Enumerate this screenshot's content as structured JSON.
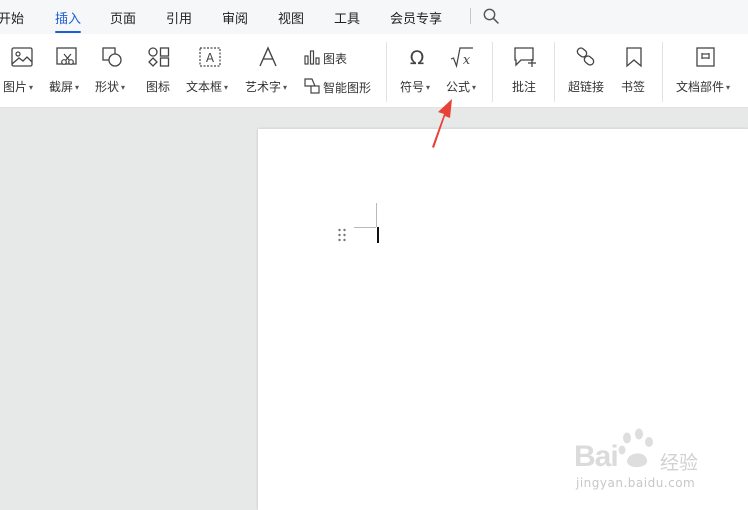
{
  "menu": {
    "tabs": [
      {
        "label": "开始"
      },
      {
        "label": "插入",
        "active": true
      },
      {
        "label": "页面"
      },
      {
        "label": "引用"
      },
      {
        "label": "审阅"
      },
      {
        "label": "视图"
      },
      {
        "label": "工具"
      },
      {
        "label": "会员专享"
      }
    ],
    "search_icon": "search-icon",
    "accent_color": "#1f5fd6"
  },
  "ribbon": {
    "picture": {
      "label": "图片",
      "icon": "picture-icon",
      "has_dropdown": true
    },
    "screenshot": {
      "label": "截屏",
      "icon": "screenshot-icon",
      "has_dropdown": true
    },
    "shape": {
      "label": "形状",
      "icon": "shape-icon",
      "has_dropdown": true
    },
    "icons": {
      "label": "图标",
      "icon": "icons-icon",
      "has_dropdown": false
    },
    "textbox": {
      "label": "文本框",
      "icon": "textbox-icon",
      "has_dropdown": true
    },
    "wordart": {
      "label": "艺术字",
      "icon": "wordart-icon",
      "has_dropdown": true
    },
    "chart": {
      "label": "图表",
      "icon": "chart-icon"
    },
    "smartart": {
      "label": "智能图形",
      "icon": "smartart-icon"
    },
    "symbol": {
      "label": "符号",
      "icon": "omega-icon",
      "has_dropdown": true
    },
    "formula": {
      "label": "公式",
      "icon": "formula-icon",
      "has_dropdown": true
    },
    "comment": {
      "label": "批注",
      "icon": "comment-icon",
      "has_dropdown": false
    },
    "hyperlink": {
      "label": "超链接",
      "icon": "link-icon",
      "has_dropdown": false
    },
    "bookmark": {
      "label": "书签",
      "icon": "bookmark-icon",
      "has_dropdown": false
    },
    "docparts": {
      "label": "文档部件",
      "icon": "docparts-icon",
      "has_dropdown": true
    }
  },
  "document": {
    "annotation_arrow_color": "#e8413a"
  },
  "watermark": {
    "brand": "Bai",
    "brand_suffix": "经验",
    "url": "jingyan.baidu.com"
  }
}
